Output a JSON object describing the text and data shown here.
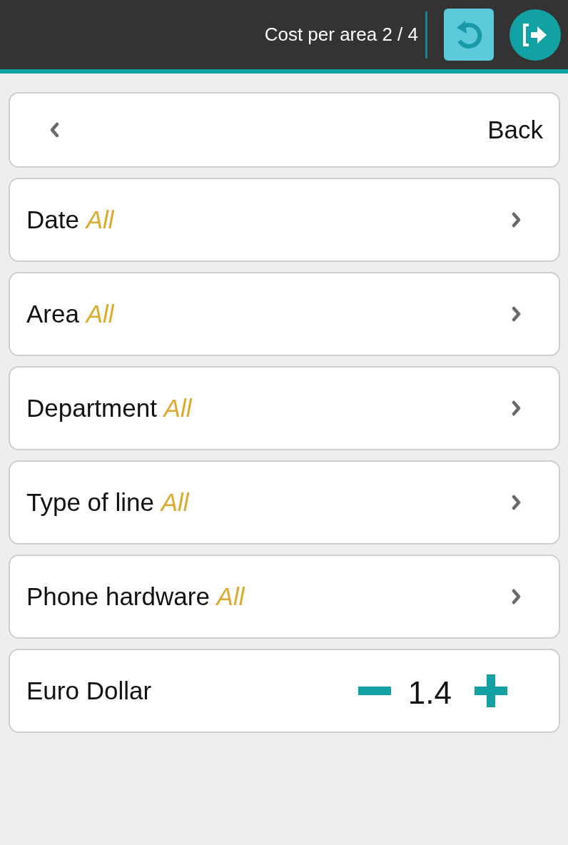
{
  "header": {
    "title": "Cost per area 2 / 4"
  },
  "back": {
    "label": "Back"
  },
  "filters": [
    {
      "label": "Date",
      "value": "All"
    },
    {
      "label": "Area",
      "value": "All"
    },
    {
      "label": "Department",
      "value": "All"
    },
    {
      "label": "Type of line",
      "value": "All"
    },
    {
      "label": "Phone hardware",
      "value": "All"
    }
  ],
  "exchange": {
    "label": "Euro Dollar",
    "value": "1.4"
  }
}
